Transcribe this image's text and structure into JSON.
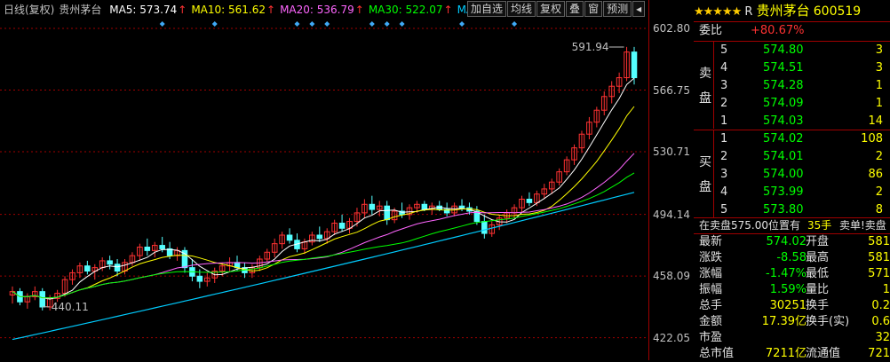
{
  "chart_data": {
    "type": "candlestick",
    "title": "日线(复权) 贵州茅台",
    "ylim": [
      412,
      608
    ],
    "y_ticks": [
      "602.80",
      "566.75",
      "530.71",
      "494.14",
      "458.09",
      "422.05"
    ],
    "annotations": [
      {
        "label": "591.94",
        "value": 591.94
      },
      {
        "label": "440.11",
        "value": 440.11
      }
    ],
    "candles": [
      [
        447,
        452,
        442,
        449
      ],
      [
        449,
        451,
        441,
        443
      ],
      [
        443,
        448,
        439,
        446
      ],
      [
        446,
        452,
        444,
        449
      ],
      [
        449,
        451,
        438,
        440
      ],
      [
        440,
        447,
        438,
        445
      ],
      [
        445,
        450,
        443,
        448
      ],
      [
        448,
        458,
        446,
        456
      ],
      [
        456,
        462,
        453,
        460
      ],
      [
        460,
        466,
        457,
        464
      ],
      [
        464,
        467,
        459,
        461
      ],
      [
        461,
        465,
        456,
        463
      ],
      [
        463,
        469,
        461,
        467
      ],
      [
        467,
        470,
        462,
        465
      ],
      [
        465,
        468,
        458,
        461
      ],
      [
        461,
        468,
        459,
        466
      ],
      [
        466,
        472,
        464,
        470
      ],
      [
        470,
        477,
        467,
        475
      ],
      [
        475,
        480,
        470,
        473
      ],
      [
        473,
        478,
        469,
        476
      ],
      [
        476,
        481,
        472,
        474
      ],
      [
        474,
        478,
        468,
        470
      ],
      [
        470,
        475,
        467,
        473
      ],
      [
        473,
        475,
        460,
        463
      ],
      [
        463,
        468,
        455,
        458
      ],
      [
        458,
        462,
        451,
        455
      ],
      [
        455,
        460,
        452,
        457
      ],
      [
        457,
        463,
        454,
        461
      ],
      [
        461,
        466,
        458,
        464
      ],
      [
        464,
        469,
        461,
        466
      ],
      [
        466,
        470,
        461,
        463
      ],
      [
        463,
        466,
        457,
        460
      ],
      [
        460,
        465,
        457,
        463
      ],
      [
        463,
        470,
        461,
        468
      ],
      [
        468,
        474,
        466,
        472
      ],
      [
        472,
        480,
        469,
        477
      ],
      [
        477,
        484,
        474,
        482
      ],
      [
        482,
        486,
        477,
        479
      ],
      [
        479,
        483,
        472,
        474
      ],
      [
        474,
        480,
        471,
        478
      ],
      [
        478,
        484,
        476,
        482
      ],
      [
        482,
        487,
        478,
        480
      ],
      [
        480,
        486,
        477,
        484
      ],
      [
        484,
        491,
        482,
        489
      ],
      [
        489,
        494,
        484,
        486
      ],
      [
        486,
        492,
        483,
        490
      ],
      [
        490,
        498,
        487,
        495
      ],
      [
        495,
        503,
        492,
        500
      ],
      [
        500,
        505,
        494,
        497
      ],
      [
        497,
        502,
        493,
        499
      ],
      [
        499,
        502,
        488,
        491
      ],
      [
        491,
        498,
        489,
        496
      ],
      [
        496,
        501,
        492,
        494
      ],
      [
        494,
        500,
        491,
        498
      ],
      [
        498,
        502,
        495,
        500
      ],
      [
        500,
        502,
        496,
        497
      ],
      [
        497,
        501,
        494,
        499
      ],
      [
        499,
        502,
        496,
        497
      ],
      [
        497,
        501,
        493,
        495
      ],
      [
        495,
        501,
        493,
        499
      ],
      [
        499,
        503,
        496,
        498
      ],
      [
        498,
        501,
        494,
        496
      ],
      [
        496,
        499,
        488,
        490
      ],
      [
        490,
        494,
        480,
        483
      ],
      [
        483,
        490,
        481,
        488
      ],
      [
        488,
        494,
        485,
        492
      ],
      [
        492,
        497,
        489,
        495
      ],
      [
        495,
        500,
        492,
        498
      ],
      [
        498,
        505,
        495,
        503
      ],
      [
        503,
        507,
        499,
        501
      ],
      [
        501,
        508,
        499,
        506
      ],
      [
        506,
        512,
        503,
        509
      ],
      [
        509,
        515,
        506,
        513
      ],
      [
        513,
        521,
        511,
        519
      ],
      [
        519,
        528,
        517,
        526
      ],
      [
        526,
        535,
        523,
        533
      ],
      [
        533,
        543,
        530,
        541
      ],
      [
        541,
        551,
        538,
        548
      ],
      [
        548,
        557,
        545,
        555
      ],
      [
        555,
        566,
        552,
        563
      ],
      [
        563,
        572,
        559,
        569
      ],
      [
        569,
        577,
        565,
        574
      ],
      [
        574,
        592,
        572,
        589
      ],
      [
        589,
        592,
        570,
        574
      ]
    ],
    "ma": [
      {
        "name": "MA5",
        "value": "573.74",
        "color": "#ffffff"
      },
      {
        "name": "MA10",
        "value": "561.62",
        "color": "#ffff00"
      },
      {
        "name": "MA20",
        "value": "536.79",
        "color": "#ff66ff"
      },
      {
        "name": "MA30",
        "value": "522.07",
        "color": "#00ff00"
      },
      {
        "name": "MA",
        "value": "",
        "color": "#00ccff"
      }
    ],
    "long_ma_start": 421,
    "long_ma_end": 507
  },
  "legend": {
    "title": "日线(复权)",
    "name": "贵州茅台",
    "up_arrow": "↑"
  },
  "toolbar": [
    "加自选",
    "均线",
    "复权",
    "叠",
    "窗",
    "预测",
    "◂"
  ],
  "quote": {
    "stars": "★★★★★",
    "mark": "R",
    "name": "贵州茅台",
    "code": "600519",
    "wei_bi_label": "委比",
    "wei_bi": "+80.67%",
    "sell_label": "卖盘",
    "buy_label": "买盘",
    "sells": [
      {
        "level": "5",
        "price": "574.80",
        "vol": "3"
      },
      {
        "level": "4",
        "price": "574.51",
        "vol": "3"
      },
      {
        "level": "3",
        "price": "574.28",
        "vol": "1"
      },
      {
        "level": "2",
        "price": "574.09",
        "vol": "1"
      },
      {
        "level": "1",
        "price": "574.03",
        "vol": "14"
      }
    ],
    "buys": [
      {
        "level": "1",
        "price": "574.02",
        "vol": "108"
      },
      {
        "level": "2",
        "price": "574.01",
        "vol": "2"
      },
      {
        "level": "3",
        "price": "574.00",
        "vol": "86"
      },
      {
        "level": "4",
        "price": "573.99",
        "vol": "2"
      },
      {
        "level": "5",
        "price": "573.80",
        "vol": "8"
      }
    ],
    "notice": "在卖盘575.00位置有",
    "notice_vol": "35手",
    "notice_tail": "卖单!卖盘",
    "stats": [
      {
        "l1": "最新",
        "v1": "574.02",
        "c1": "#00ff00",
        "l2": "开盘",
        "v2": "581"
      },
      {
        "l1": "涨跌",
        "v1": "-8.58",
        "c1": "#00ff00",
        "l2": "最高",
        "v2": "581"
      },
      {
        "l1": "涨幅",
        "v1": "-1.47%",
        "c1": "#00ff00",
        "l2": "最低",
        "v2": "571"
      },
      {
        "l1": "振幅",
        "v1": "1.59%",
        "c1": "#00ff00",
        "l2": "量比",
        "v2": "1"
      },
      {
        "l1": "总手",
        "v1": "30251",
        "c1": "#ffff00",
        "l2": "换手",
        "v2": "0.2"
      },
      {
        "l1": "金额",
        "v1": "17.39亿",
        "c1": "#ffff00",
        "l2": "换手(实)",
        "v2": "0.6"
      },
      {
        "l1": "市盈",
        "v1": "",
        "c1": "#ffff00",
        "l2": "",
        "v2": "32"
      },
      {
        "l1": "总市值",
        "v1": "7211亿",
        "c1": "#ffff00",
        "l2": "流通值",
        "v2": "721"
      }
    ]
  },
  "colors": {
    "up": "#ff3232",
    "down": "#54ffff",
    "grid": "#a00000",
    "accent_red": "#ff3232",
    "green": "#00ff00",
    "yellow": "#ffff00"
  }
}
